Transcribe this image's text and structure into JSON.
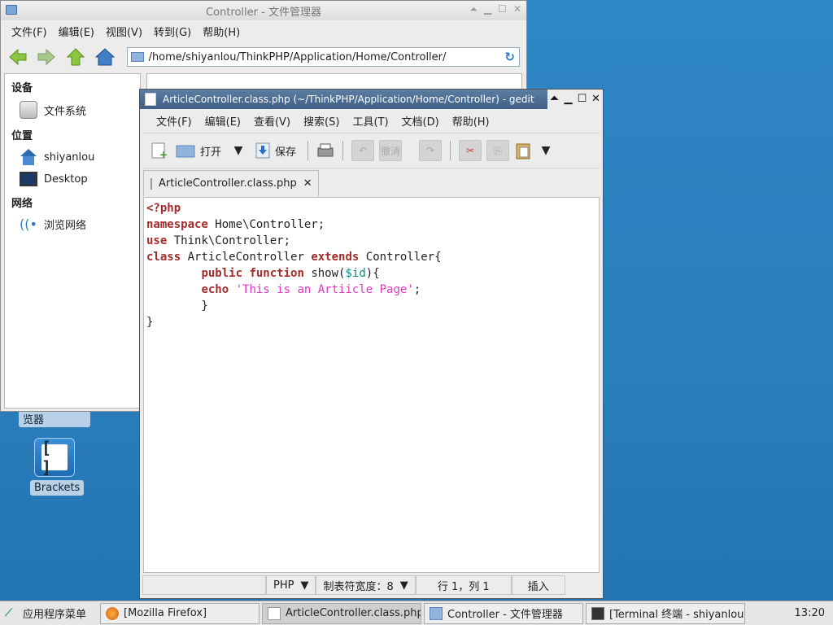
{
  "desktop": {
    "partial_label": "览器",
    "brackets_label": "Brackets"
  },
  "file_manager": {
    "title": "Controller - 文件管理器",
    "menu": [
      "文件(F)",
      "编辑(E)",
      "视图(V)",
      "转到(G)",
      "帮助(H)"
    ],
    "address": "/home/shiyanlou/ThinkPHP/Application/Home/Controller/",
    "sidebar": {
      "devices_heading": "设备",
      "filesystem": "文件系统",
      "places_heading": "位置",
      "home": "shiyanlou",
      "desktop": "Desktop",
      "network_heading": "网络",
      "browse_network": "浏览网络"
    }
  },
  "gedit": {
    "title": "ArticleController.class.php (~/ThinkPHP/Application/Home/Controller) - gedit",
    "menu": [
      "文件(F)",
      "编辑(E)",
      "查看(V)",
      "搜索(S)",
      "工具(T)",
      "文档(D)",
      "帮助(H)"
    ],
    "toolbar": {
      "open": "打开",
      "save": "保存",
      "undo": "撤消"
    },
    "tab_label": "ArticleController.class.php",
    "code": [
      "<?php",
      "namespace Home\\Controller;",
      "use Think\\Controller;",
      "class ArticleController extends Controller{",
      "        public function show($id){",
      "        echo 'This is an Artiicle Page';",
      "        }",
      "}"
    ],
    "status": {
      "language": "PHP",
      "tab_width": "制表符宽度：8",
      "position": "行 1，列 1",
      "mode": "插入"
    }
  },
  "taskbar": {
    "app_menu": "应用程序菜单",
    "tasks": [
      "[Mozilla Firefox]",
      "ArticleController.class.php (…",
      "Controller - 文件管理器",
      "[Terminal 终端 - shiyanlou@…"
    ],
    "clock": "13:20"
  },
  "colors": {
    "desktop": "#2b7fbd",
    "keyword": "#a52a2a",
    "string": "#e236c4",
    "variable": "#008a8c"
  }
}
